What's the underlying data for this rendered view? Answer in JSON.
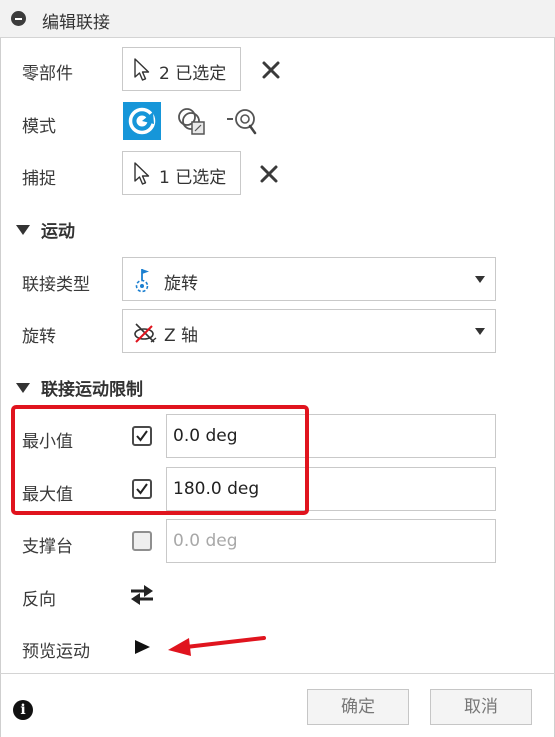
{
  "title": "编辑联接",
  "components": {
    "label": "零部件",
    "selection": "2 已选定"
  },
  "mode": {
    "label": "模式"
  },
  "snap": {
    "label": "捕捉",
    "selection": "1 已选定"
  },
  "motion_section": "运动",
  "joint_type": {
    "label": "联接类型",
    "value": "旋转"
  },
  "rotation": {
    "label": "旋转",
    "value": "Z 轴"
  },
  "limits_section": "联接运动限制",
  "min": {
    "label": "最小值",
    "checked": true,
    "value": "0.0 deg"
  },
  "max": {
    "label": "最大值",
    "checked": true,
    "value": "180.0 deg"
  },
  "rest": {
    "label": "支撑台",
    "checked": false,
    "value": "0.0 deg"
  },
  "reverse": {
    "label": "反向"
  },
  "preview": {
    "label": "预览运动"
  },
  "footer": {
    "ok": "确定",
    "cancel": "取消"
  },
  "colors": {
    "accent": "#1696d9",
    "highlight": "#e0141e"
  }
}
